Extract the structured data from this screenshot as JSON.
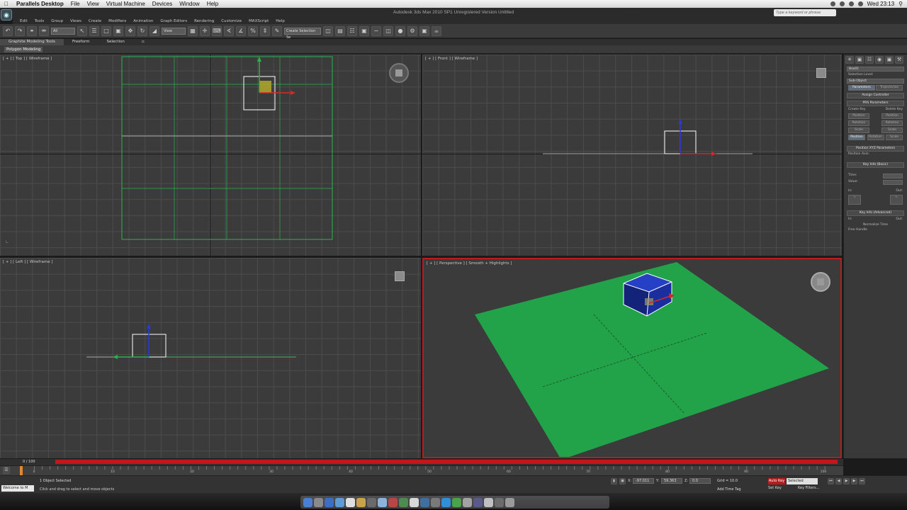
{
  "mac_menubar": {
    "app": "Parallels Desktop",
    "menus": [
      "File",
      "View",
      "Virtual Machine",
      "Devices",
      "Window",
      "Help"
    ],
    "clock": "Wed 23:13"
  },
  "titlebar": {
    "title": "Autodesk 3ds Max 2010 SP1     Unregistered Version     Untitled",
    "search_placeholder": "Type a keyword or phrase",
    "menus": [
      "Edit",
      "Tools",
      "Group",
      "Views",
      "Create",
      "Modifiers",
      "Animation",
      "Graph Editors",
      "Rendering",
      "Customize",
      "MAXScript",
      "Help"
    ]
  },
  "toolbar": {
    "selection_filter": "All",
    "view_dropdown": "View",
    "named_selection": "Create Selection Se"
  },
  "ribbon": {
    "tabs": [
      "Graphite Modeling Tools",
      "Freeform",
      "Selection"
    ],
    "active_tab": "Graphite Modeling Tools",
    "panel": "Polygon Modeling"
  },
  "viewports": {
    "top": {
      "label": "[ + ] [ Top ] [ Wireframe ]"
    },
    "front": {
      "label": "[ + ] [ Front ] [ Wireframe ]"
    },
    "left": {
      "label": "[ + ] [ Left ] [ Wireframe ]"
    },
    "perspective": {
      "label": "[ + ] [ Perspective ] [ Smooth + Highlights ]"
    }
  },
  "command_panel": {
    "object_name": "Box01",
    "selection_level": "Selection Level:",
    "sub_object": "Sub-Object",
    "buttons": [
      "Parameters",
      "Trajectories"
    ],
    "rollouts": {
      "assign_controller": "Assign Controller",
      "prs_parameters": "PRS Parameters",
      "position_xyz": "Position XYZ Parameters",
      "key_info_basic": "Key Info (Basic)",
      "key_info_advanced": "Key Info (Advanced)"
    },
    "create_key": "Create Key",
    "delete_key": "Delete Key",
    "key_buttons": [
      "Position",
      "Rotation",
      "Scale"
    ],
    "prs_tabs": [
      "Position",
      "Rotation",
      "Scale"
    ],
    "position_axis": "Position Axis:",
    "time_label": "Time:",
    "value_label": "Value:",
    "in_label": "In:",
    "out_label": "Out:",
    "normalize_time": "Normalize Time",
    "free_handle": "Free Handle"
  },
  "timeline": {
    "frame_counter": "0 / 100",
    "tick_labels": [
      "0",
      "10",
      "20",
      "30",
      "40",
      "50",
      "60",
      "70",
      "80",
      "90",
      "100"
    ]
  },
  "status": {
    "maxscript": "Welcome to M",
    "selected": "1 Object Selected",
    "prompt": "Click and drag to select and move objects",
    "x_label": "X:",
    "y_label": "Y:",
    "z_label": "Z:",
    "x_value": "-97.011",
    "y_value": "59.363",
    "z_value": "0.0",
    "grid": "Grid = 10.0",
    "add_time_tag": "Add Time Tag",
    "auto_key": "Auto Key",
    "selection_mode": "Selected",
    "set_key": "Set Key",
    "key_filters": "Key Filters..."
  },
  "colors": {
    "viewport_bg": "#3b3b3b",
    "grid_line": "#4c4c4c",
    "plane": "#22a34a",
    "box": "#1a2e9e",
    "active_border": "#b81c1c",
    "time_slider": "#c4141c"
  },
  "icons": [
    "apple-icon",
    "app-logo-icon",
    "undo-icon",
    "redo-icon",
    "select-icon",
    "move-icon",
    "rotate-icon",
    "scale-icon",
    "snap-icon",
    "render-icon",
    "create-tab-icon",
    "modify-tab-icon",
    "motion-tab-icon",
    "play-icon"
  ]
}
